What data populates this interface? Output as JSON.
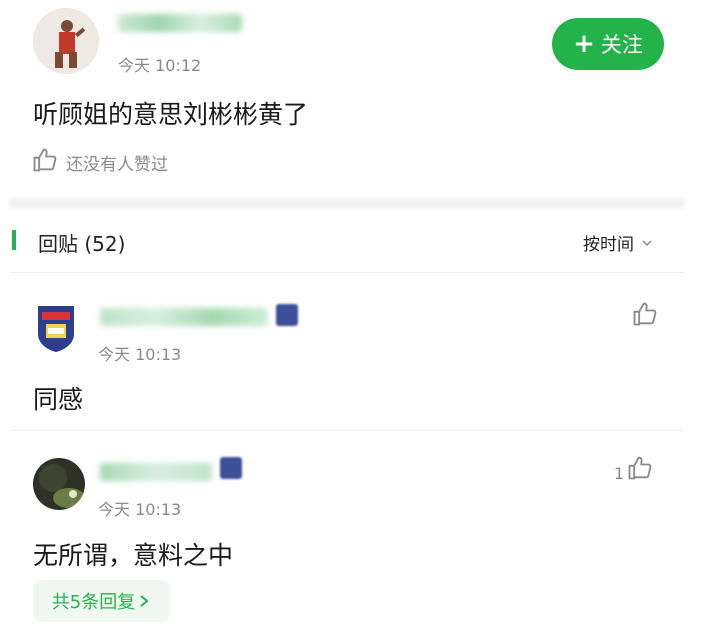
{
  "post": {
    "time": "今天 10:12",
    "follow_label": "关注",
    "body": "听顾姐的意思刘彬彬黄了",
    "like_status": "还没有人赞过"
  },
  "replies_header": {
    "title": "回贴 (52)",
    "sort_label": "按时间"
  },
  "comments": [
    {
      "time": "今天 10:13",
      "text": "同感",
      "likes": ""
    },
    {
      "time": "今天 10:13",
      "text": "无所谓，意料之中",
      "likes": "1",
      "replies_label": "共5条回复"
    }
  ],
  "colors": {
    "accent": "#24b34a",
    "muted": "#8a8a8a"
  }
}
